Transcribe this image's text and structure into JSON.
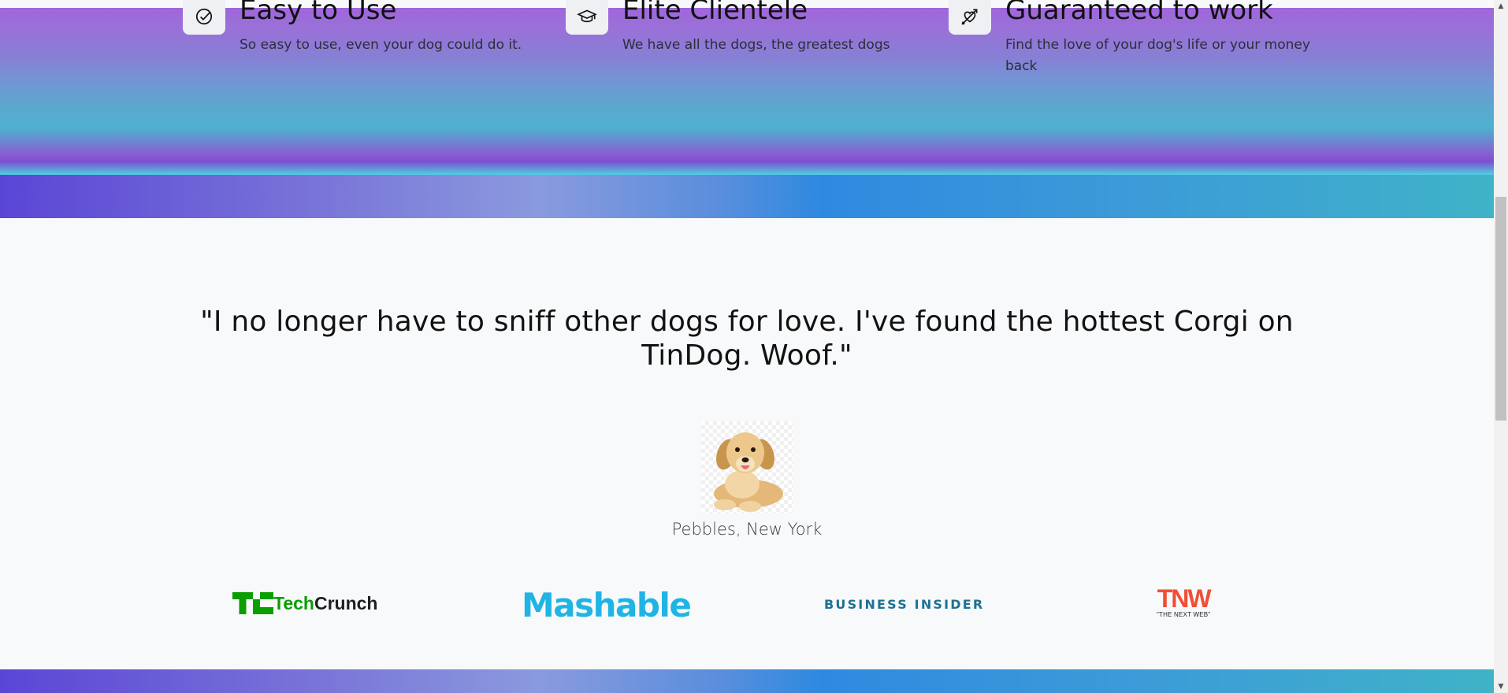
{
  "features": [
    {
      "title": "Easy to Use",
      "text": "So easy to use, even your dog could do it.",
      "icon": "circle-check-icon"
    },
    {
      "title": "Elite Clientele",
      "text": "We have all the dogs, the greatest dogs",
      "icon": "mortarboard-icon"
    },
    {
      "title": "Guaranteed to work",
      "text": "Find the love of your dog's life or your money back",
      "icon": "heart-arrow-icon"
    }
  ],
  "testimonial": {
    "quote": "\"I no longer have to sniff other dogs for love. I've found the hottest Corgi on TinDog. Woof.\"",
    "author": "Pebbles, New York",
    "image": "puppy-photo"
  },
  "press": {
    "techcrunch": {
      "part1": "Tech",
      "part2": "Crunch"
    },
    "mashable": "Mashable",
    "business_insider": "BUSINESS INSIDER",
    "tnw": {
      "big": "TNW",
      "small": "\"THE NEXT WEB\""
    }
  },
  "colors": {
    "feature_band_top": "#a066dc",
    "strip_mid": "#2e8ae0",
    "techcrunch_green": "#0a9e01",
    "mashable_blue": "#1fb4e4",
    "bi_blue": "#1d7193",
    "tnw_red": "#f04f36"
  }
}
